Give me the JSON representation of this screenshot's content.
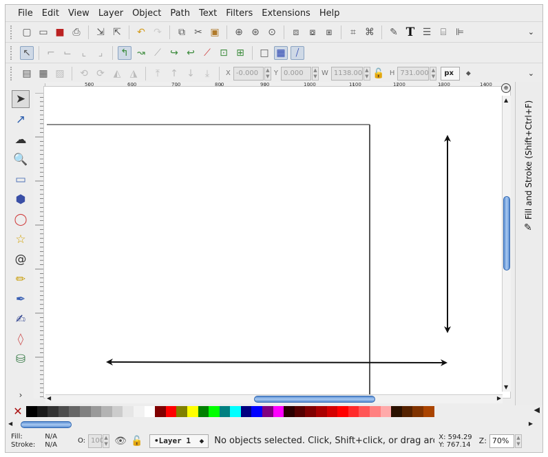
{
  "menu": [
    "File",
    "Edit",
    "View",
    "Layer",
    "Object",
    "Path",
    "Text",
    "Filters",
    "Extensions",
    "Help"
  ],
  "toolbar": {
    "x_label": "X",
    "x_value": "-0.000",
    "y_label": "Y",
    "y_value": "0.000",
    "w_label": "W",
    "w_value": "1138.00",
    "h_label": "H",
    "h_value": "731.000",
    "unit": "px"
  },
  "ruler": {
    "marks": [
      "500",
      "600",
      "700",
      "800",
      "900",
      "1000",
      "1100",
      "1200",
      "1300",
      "1400"
    ]
  },
  "dock": {
    "panel_title": "Fill and Stroke (Shift+Ctrl+F)"
  },
  "palette": {
    "colors": [
      "#000000",
      "#1a1a1a",
      "#333333",
      "#4d4d4d",
      "#666666",
      "#808080",
      "#999999",
      "#b3b3b3",
      "#cccccc",
      "#e6e6e6",
      "#f2f2f2",
      "#ffffff",
      "#800000",
      "#ff0000",
      "#808000",
      "#ffff00",
      "#008000",
      "#00ff00",
      "#008080",
      "#00ffff",
      "#000080",
      "#0000ff",
      "#800080",
      "#ff00ff",
      "#2b0000",
      "#550000",
      "#800000",
      "#aa0000",
      "#d40000",
      "#ff0000",
      "#ff2a2a",
      "#ff5555",
      "#ff8080",
      "#ffaaaa",
      "#2b1100",
      "#552200",
      "#803300",
      "#aa4400"
    ]
  },
  "status": {
    "fill_label": "Fill:",
    "fill_value": "N/A",
    "stroke_label": "Stroke:",
    "stroke_value": "N/A",
    "opacity_label": "O:",
    "opacity_value": "100",
    "layer": "•Layer 1",
    "message": "No objects selected. Click, Shift+click, or drag arou...",
    "x_label": "X:",
    "x_value": "594.29",
    "y_label": "Y:",
    "y_value": "767.14",
    "zoom_label": "Z:",
    "zoom_value": "70%"
  }
}
